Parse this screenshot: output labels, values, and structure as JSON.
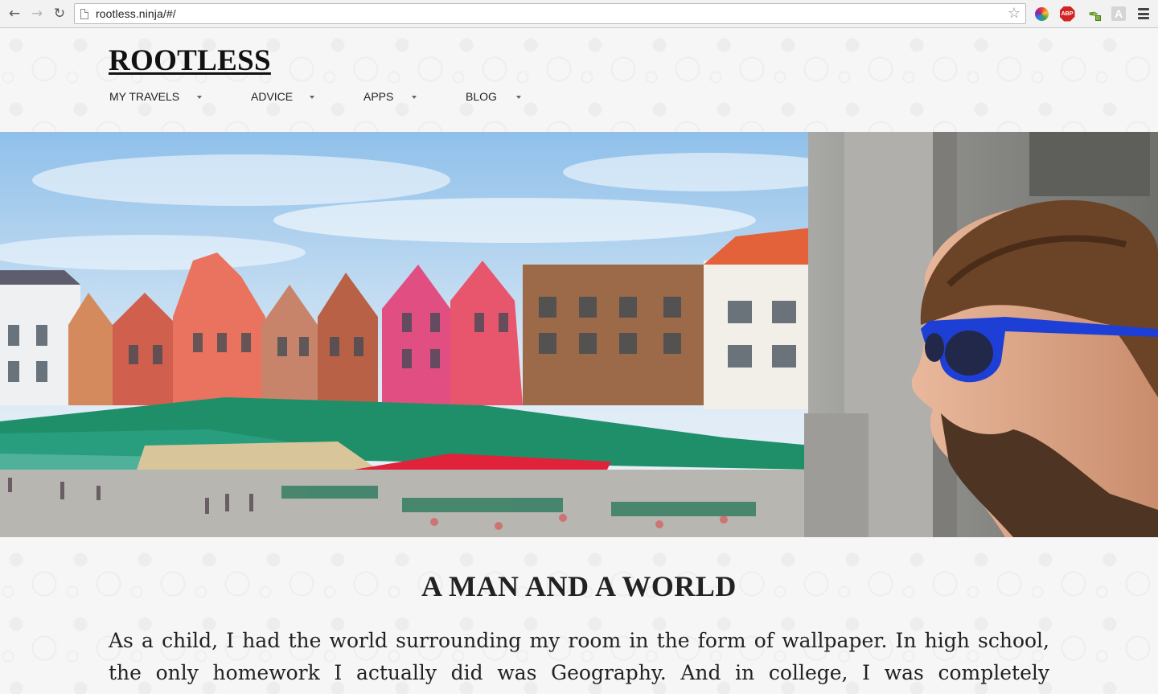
{
  "browser": {
    "url": "rootless.ninja/#/",
    "back_icon": "arrow-left-icon",
    "forward_icon": "arrow-right-icon",
    "reload_icon": "reload-icon",
    "bookmark_icon": "star-icon",
    "extensions": [
      "color-picker-icon",
      "adblock-plus-icon",
      "eyedropper-icon",
      "readability-icon"
    ],
    "menu_icon": "hamburger-menu-icon"
  },
  "site": {
    "logo": "ROOTLESS",
    "nav": [
      {
        "label": "MY TRAVELS"
      },
      {
        "label": "ADVICE"
      },
      {
        "label": "APPS"
      },
      {
        "label": "BLOG"
      }
    ]
  },
  "hero": {
    "description_icon": "hero-photo"
  },
  "article": {
    "title": "A MAN AND A WORLD",
    "paragraph": "As a child, I had the world surrounding my room in the form of wallpaper. In high school, the only homework I actually did was Geography. And in college, I was completely enthralled with foreign"
  },
  "colors": {
    "background": "#f6f6f6",
    "text": "#222222",
    "sunglasses": "#1e3fd6",
    "awnings": "#1f8f6a"
  }
}
